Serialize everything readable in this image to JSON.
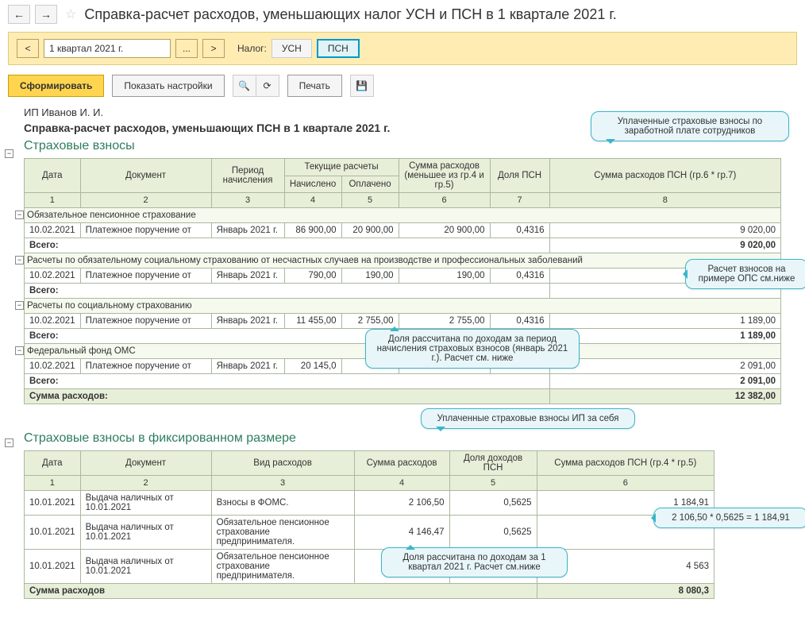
{
  "titlebar": {
    "title": "Справка-расчет расходов, уменьшающих налог УСН и ПСН в 1 квартале 2021 г."
  },
  "yellowbar": {
    "period": "1 квартал 2021 г.",
    "tax_label": "Налог:",
    "tax_usn": "УСН",
    "tax_psn": "ПСН"
  },
  "toolbar": {
    "form": "Сформировать",
    "settings": "Показать настройки",
    "print": "Печать"
  },
  "report": {
    "org": "ИП Иванов И. И.",
    "title": "Справка-расчет расходов, уменьшающих ПСН в 1 квартале 2021 г.",
    "section1": {
      "title": "Страховые взносы",
      "headers": {
        "c1": "Дата",
        "c2": "Документ",
        "c3": "Период начисления",
        "c45": "Текущие расчеты",
        "c4": "Начислено",
        "c5": "Оплачено",
        "c6": "Сумма расходов (меньшее из гр.4 и гр.5)",
        "c7": "Доля ПСН",
        "c8": "Сумма расходов ПСН (гр.6 * гр.7)"
      },
      "nums": {
        "n1": "1",
        "n2": "2",
        "n3": "3",
        "n4": "4",
        "n5": "5",
        "n6": "6",
        "n7": "7",
        "n8": "8"
      },
      "groups": [
        {
          "name": "Обязательное пенсионное страхование",
          "rows": [
            {
              "date": "10.02.2021",
              "doc": "Платежное поручение от",
              "period": "Январь 2021 г.",
              "ach": "86 900,00",
              "opl": "20 900,00",
              "sum": "20 900,00",
              "share": "0,4316",
              "psn": "9 020,00"
            }
          ],
          "total": "9 020,00"
        },
        {
          "name": "Расчеты по обязательному социальному страхованию от несчастных случаев на производстве и профессиональных заболеваний",
          "rows": [
            {
              "date": "10.02.2021",
              "doc": "Платежное поручение от",
              "period": "Январь 2021 г.",
              "ach": "790,00",
              "opl": "190,00",
              "sum": "190,00",
              "share": "0,4316",
              "psn": ""
            }
          ],
          "total": ""
        },
        {
          "name": "Расчеты по социальному страхованию",
          "rows": [
            {
              "date": "10.02.2021",
              "doc": "Платежное поручение от",
              "period": "Январь 2021 г.",
              "ach": "11 455,00",
              "opl": "2 755,00",
              "sum": "2 755,00",
              "share": "0,4316",
              "psn": "1 189,00"
            }
          ],
          "total": "1 189,00"
        },
        {
          "name": "Федеральный фонд ОМС",
          "rows": [
            {
              "date": "10.02.2021",
              "doc": "Платежное поручение от",
              "period": "Январь 2021 г.",
              "ach": "20 145,0",
              "opl": "",
              "sum": "",
              "share": "",
              "psn": "2 091,00"
            }
          ],
          "total": "2 091,00"
        }
      ],
      "total_label": "Всего:",
      "grand_label": "Сумма расходов:",
      "grand_total": "12 382,00"
    },
    "section2": {
      "title": "Страховые взносы в фиксированном размере",
      "headers": {
        "c1": "Дата",
        "c2": "Документ",
        "c3": "Вид расходов",
        "c4": "Сумма расходов",
        "c5": "Доля доходов ПСН",
        "c6": "Сумма расходов ПСН (гр.4 * гр.5)"
      },
      "nums": {
        "n1": "1",
        "n2": "2",
        "n3": "3",
        "n4": "4",
        "n5": "5",
        "n6": "6"
      },
      "rows": [
        {
          "date": "10.01.2021",
          "doc": "Выдача наличных  от 10.01.2021",
          "type": "Взносы в ФОМС.",
          "sum": "2 106,50",
          "share": "0,5625",
          "psn": "1 184,91"
        },
        {
          "date": "10.01.2021",
          "doc": "Выдача наличных  от 10.01.2021",
          "type": "Обязательное пенсионное страхование предпринимателя.",
          "sum": "4 146,47",
          "share": "0,5625",
          "psn": ""
        },
        {
          "date": "10.01.2021",
          "doc": "Выдача наличных  от 10.01.2021",
          "type": "Обязательное пенсионное страхование предпринимателя.",
          "sum": "",
          "share": "",
          "psn": "4 563"
        }
      ],
      "grand_label": "Сумма расходов",
      "grand_total": "8 080,3"
    }
  },
  "callouts": {
    "c1": "Уплаченные страховые взносы по заработной плате сотрудников",
    "c2": "Расчет взносов на примере ОПС см.ниже",
    "c3": "Доля рассчитана по доходам за период начисления страховых взносов (январь 2021 г.). Расчет см. ниже",
    "c4": "Уплаченные страховые взносы ИП за себя",
    "c5": "2 106,50 * 0,5625 = 1 184,91",
    "c6": "Доля рассчитана по доходам за 1 квартал 2021 г. Расчет см.ниже"
  }
}
